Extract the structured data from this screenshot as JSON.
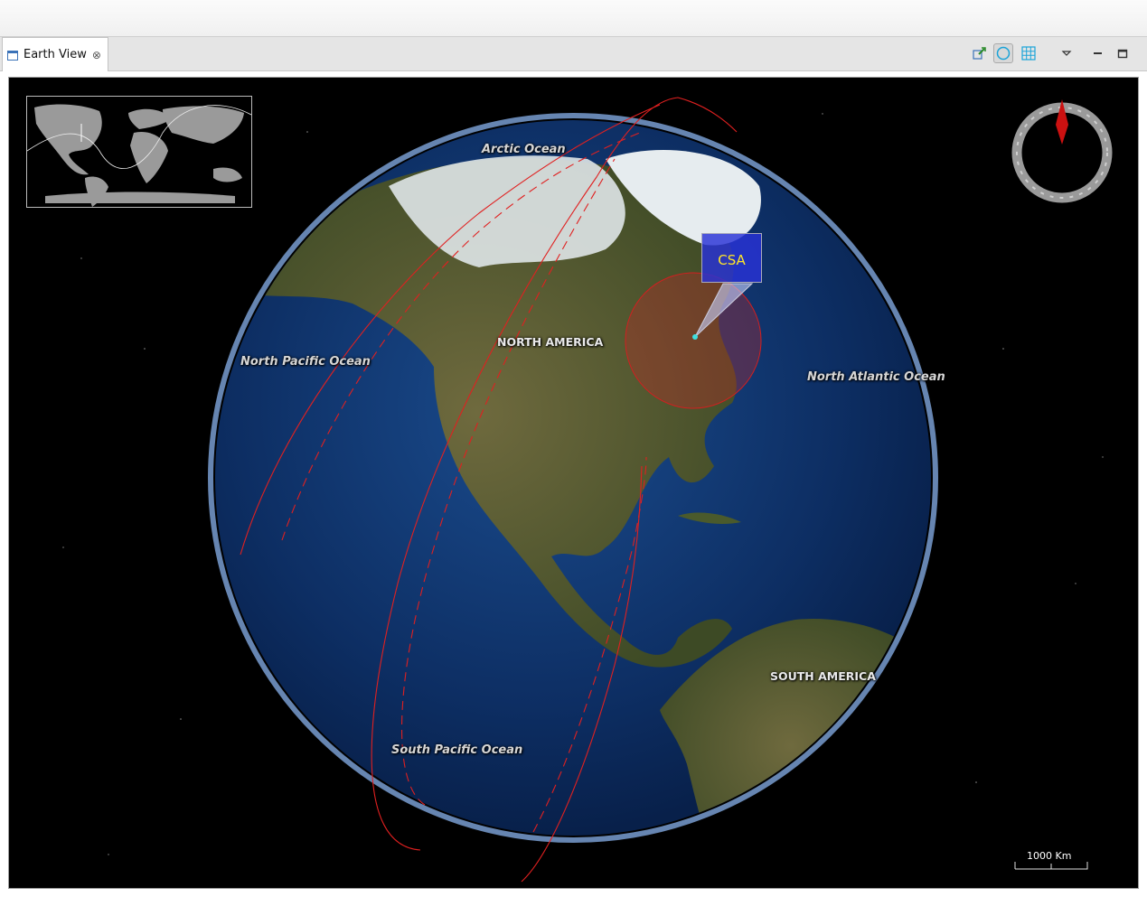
{
  "tab": {
    "label": "Earth View",
    "close_glyph": "⊗"
  },
  "toolbar": [
    {
      "name": "pin-icon",
      "glyph": ""
    },
    {
      "name": "globe-view-icon",
      "glyph": ""
    },
    {
      "name": "grid-view-icon",
      "glyph": ""
    },
    {
      "name": "view-menu-icon",
      "glyph": "▽"
    },
    {
      "name": "minimize-icon",
      "glyph": "—"
    },
    {
      "name": "maximize-icon",
      "glyph": ""
    }
  ],
  "map": {
    "oceans": {
      "arctic": "Arctic Ocean",
      "north_pacific": "North Pacific Ocean",
      "north_atlantic": "North Atlantic Ocean",
      "south_pacific": "South Pacific Ocean"
    },
    "continents": {
      "north_america": "NORTH AMERICA",
      "south_america": "SOUTH AMERICA"
    },
    "marker": {
      "label": "CSA",
      "label_color": "#ffe629",
      "box_color": "#2832d7"
    },
    "scale": "1000 Km",
    "colors": {
      "orbit": "#e02020",
      "ocean": "#0c2f66",
      "compass_needle": "#cc1111"
    }
  }
}
